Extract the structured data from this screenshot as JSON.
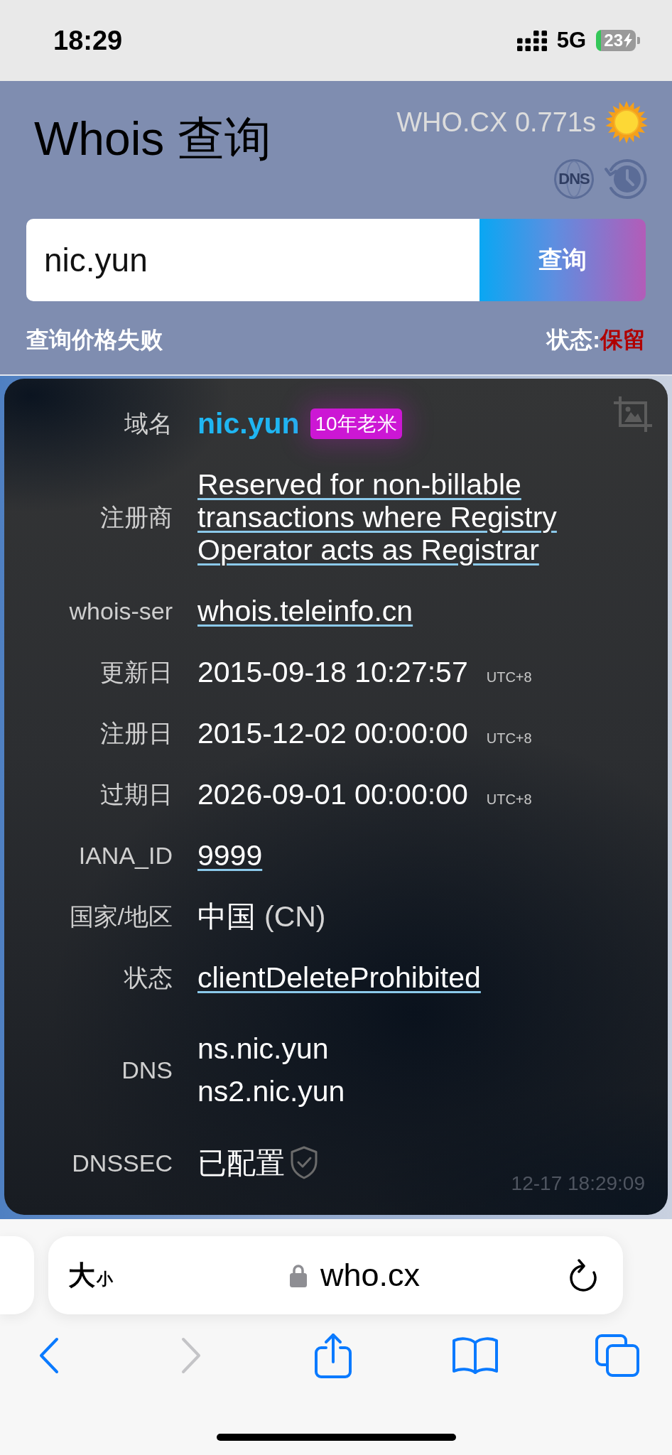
{
  "status_bar": {
    "time": "18:29",
    "network": "5G",
    "battery": "23"
  },
  "header": {
    "title": "Whois 查询",
    "timing": "WHO.CX 0.771s",
    "dns_button": "DNS"
  },
  "search": {
    "value": "nic.yun",
    "button": "查询"
  },
  "price_message": "查询价格失败",
  "status": {
    "label": "状态:",
    "value": "保留"
  },
  "result": {
    "rows": [
      {
        "kind": "domain",
        "label": "域名",
        "value": "nic.yun",
        "badge": "10年老米"
      },
      {
        "kind": "link",
        "label": "注册商",
        "value": "Reserved for non-billable transactions where Registry Operator acts as Registrar"
      },
      {
        "kind": "link",
        "label": "whois-ser",
        "value": "whois.teleinfo.cn"
      },
      {
        "kind": "date",
        "label": "更新日",
        "value": "2015-09-18 10:27:57",
        "zone": "UTC+8"
      },
      {
        "kind": "date",
        "label": "注册日",
        "value": "2015-12-02 00:00:00",
        "zone": "UTC+8"
      },
      {
        "kind": "date",
        "label": "过期日",
        "value": "2026-09-01 00:00:00",
        "zone": "UTC+8"
      },
      {
        "kind": "link",
        "label": "IANA_ID",
        "value": "9999"
      },
      {
        "kind": "country",
        "label": "国家/地区",
        "value": "中国",
        "code": "(CN)"
      },
      {
        "kind": "link",
        "label": "状态",
        "value": "clientDeleteProhibited"
      },
      {
        "kind": "list",
        "label": "DNS",
        "values": [
          "ns.nic.yun",
          "ns2.nic.yun"
        ]
      },
      {
        "kind": "dnssec",
        "label": "DNSSEC",
        "value": "已配置"
      }
    ],
    "timestamp": "12-17 18:29:09"
  },
  "browser": {
    "text_size": {
      "large": "大",
      "small": "小"
    },
    "url": "who.cx",
    "toolbar": [
      {
        "kind": "back",
        "disabled": false
      },
      {
        "kind": "forward",
        "disabled": true
      },
      {
        "kind": "share",
        "disabled": false
      },
      {
        "kind": "bookmarks",
        "disabled": false
      },
      {
        "kind": "tabs",
        "disabled": false
      }
    ]
  }
}
